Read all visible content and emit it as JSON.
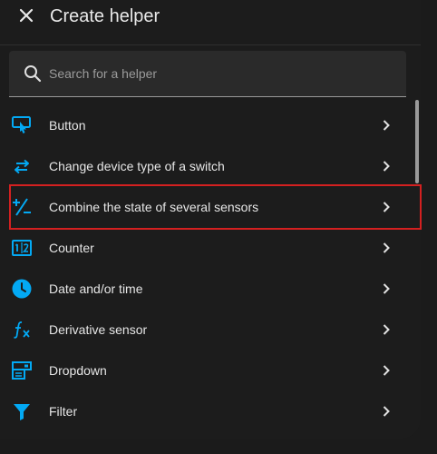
{
  "header": {
    "title": "Create helper",
    "close_icon": "close-icon"
  },
  "search": {
    "placeholder": "Search for a helper",
    "value": "",
    "icon": "search-icon"
  },
  "colors": {
    "accent": "#03a9f4",
    "highlight_border": "#d42020"
  },
  "items": [
    {
      "label": "Button",
      "icon": "touch-button-icon"
    },
    {
      "label": "Change device type of a switch",
      "icon": "swap-arrows-icon"
    },
    {
      "label": "Combine the state of several sensors",
      "icon": "plus-minus-icon"
    },
    {
      "label": "Counter",
      "icon": "counter-icon"
    },
    {
      "label": "Date and/or time",
      "icon": "clock-icon"
    },
    {
      "label": "Derivative sensor",
      "icon": "function-icon"
    },
    {
      "label": "Dropdown",
      "icon": "dropdown-form-icon"
    },
    {
      "label": "Filter",
      "icon": "filter-icon"
    }
  ]
}
